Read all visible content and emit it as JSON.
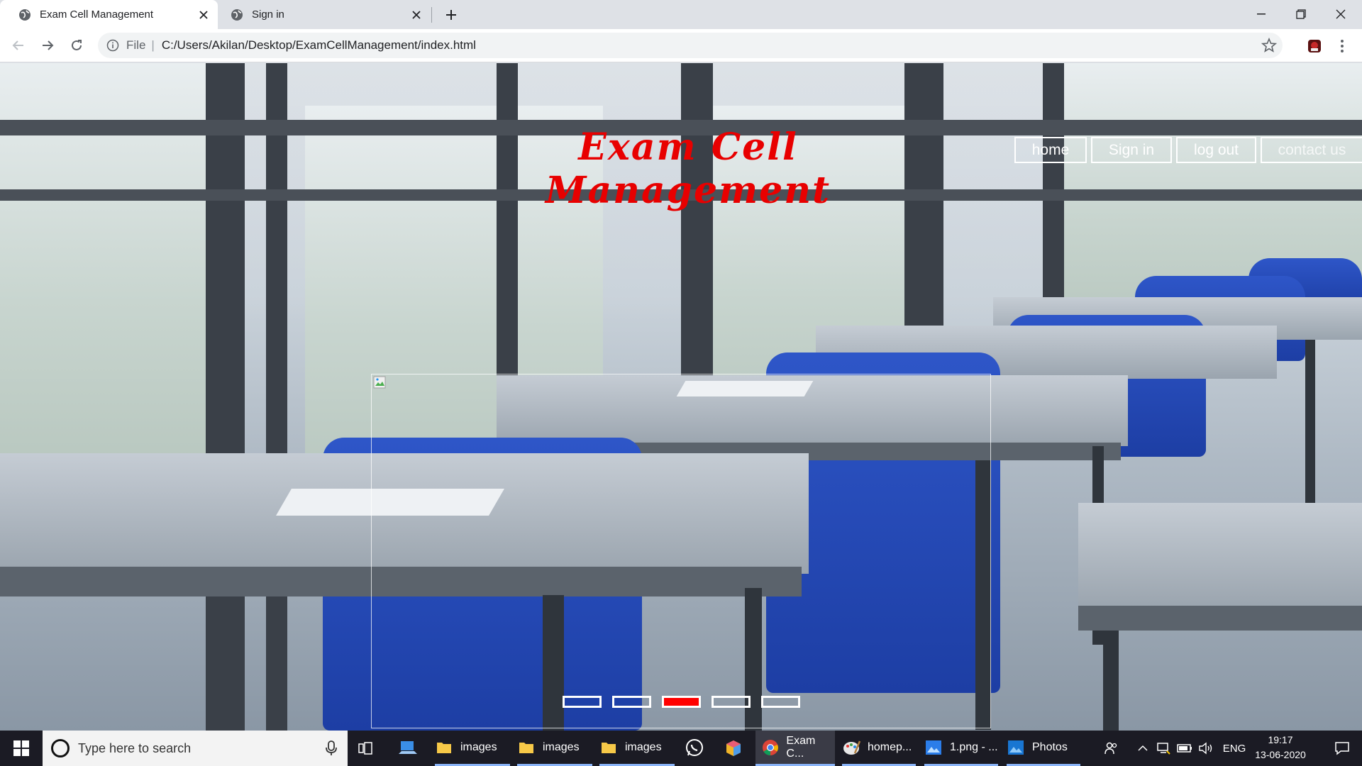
{
  "browser": {
    "tabs": [
      {
        "title": "Exam Cell Management",
        "active": true,
        "icon": "globe-icon"
      },
      {
        "title": "Sign in",
        "active": false,
        "icon": "globe-icon"
      }
    ],
    "address": {
      "scheme_label": "File",
      "url": "C:/Users/Akilan/Desktop/ExamCellManagement/index.html"
    }
  },
  "page": {
    "title": "Exam Cell Management",
    "nav": [
      {
        "label": "home"
      },
      {
        "label": "Sign in"
      },
      {
        "label": "log out"
      },
      {
        "label": "contact us"
      }
    ],
    "slider": {
      "slide_count": 5,
      "active_index": 2
    },
    "colors": {
      "title": "#e80000",
      "active_dot": "#ff0000"
    }
  },
  "taskbar": {
    "search_placeholder": "Type here to search",
    "items": [
      {
        "label": "images",
        "icon": "folder-icon"
      },
      {
        "label": "images",
        "icon": "folder-icon"
      },
      {
        "label": "images",
        "icon": "folder-icon"
      },
      {
        "label": "Exam C...",
        "icon": "chrome-icon"
      },
      {
        "label": "homep...",
        "icon": "paint-icon"
      },
      {
        "label": "1.png - ...",
        "icon": "image-icon"
      },
      {
        "label": "Photos",
        "icon": "photos-icon"
      }
    ],
    "language": "ENG",
    "time": "19:17",
    "date": "13-06-2020"
  }
}
